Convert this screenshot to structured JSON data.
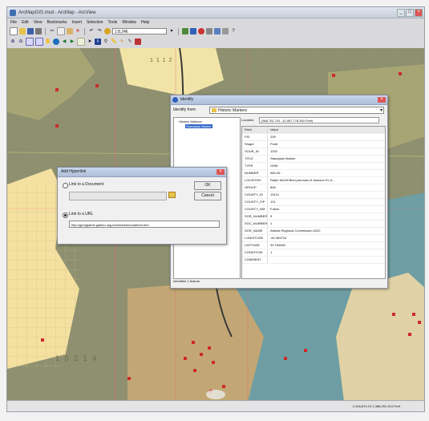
{
  "window": {
    "title": "ArcMapGIS.mxd - ArcMap - ArcView",
    "controls": [
      "_",
      "□",
      "×"
    ]
  },
  "menu": [
    "File",
    "Edit",
    "View",
    "Bookmarks",
    "Insert",
    "Selection",
    "Tools",
    "Window",
    "Help"
  ],
  "toolbar": {
    "scale": "1:8,246"
  },
  "map": {
    "parcel_number_top": "1 1 1 2",
    "parcel_number_bottom": "1 0 2 1 4"
  },
  "identify": {
    "title": "Identify",
    "identify_from_label": "Identify from:",
    "identify_from_value": "Historic Markers",
    "tree_root": "Historic Markers",
    "tree_child": "Standpipe Marker",
    "location_label": "Location:",
    "location_value": "(566,751.791 -12,967,778.340 Feet)",
    "columns": [
      "Field",
      "Value"
    ],
    "rows": [
      {
        "field": "FID",
        "value": "239"
      },
      {
        "field": "Shape",
        "value": "Point"
      },
      {
        "field": "SOUR_ID",
        "value": "1252"
      },
      {
        "field": "TITLE",
        "value": "Standpipe Marker"
      },
      {
        "field": "TYPE",
        "value": "GHM"
      },
      {
        "field": "NUMBER",
        "value": "060-45"
      },
      {
        "field": "LOCATION",
        "value": "Ralph McGill Blvd just east of Jackson St, A..."
      },
      {
        "field": "GROUP",
        "value": "846"
      },
      {
        "field": "COUNTY_ID",
        "value": "13121"
      },
      {
        "field": "COUNTY_FIP",
        "value": "121"
      },
      {
        "field": "COUNTY_NM",
        "value": "Fulton"
      },
      {
        "field": "SOR_NUMBER",
        "value": "9"
      },
      {
        "field": "SOC_NUMBER",
        "value": "1"
      },
      {
        "field": "SOR_NAME",
        "value": "Atlanta Regional Commission-NGC"
      },
      {
        "field": "LONGITUDE",
        "value": "-84.369724"
      },
      {
        "field": "LATITUDE",
        "value": "33.764653"
      },
      {
        "field": "CONDITION",
        "value": "1"
      },
      {
        "field": "COMMENT",
        "value": ""
      }
    ],
    "footer": "Identified 1 feature"
  },
  "hyperlink": {
    "title": "Add Hyperlink",
    "option_document": "Link to a Document",
    "option_url": "Link to a URL",
    "url_value": "http://georgiainfo.galileo.usg.edu/markers/markers.htm",
    "ok": "OK",
    "cancel": "Cancel"
  },
  "status": {
    "left": "",
    "right": "2,346,874.19  1,388,251.324 Feet"
  }
}
